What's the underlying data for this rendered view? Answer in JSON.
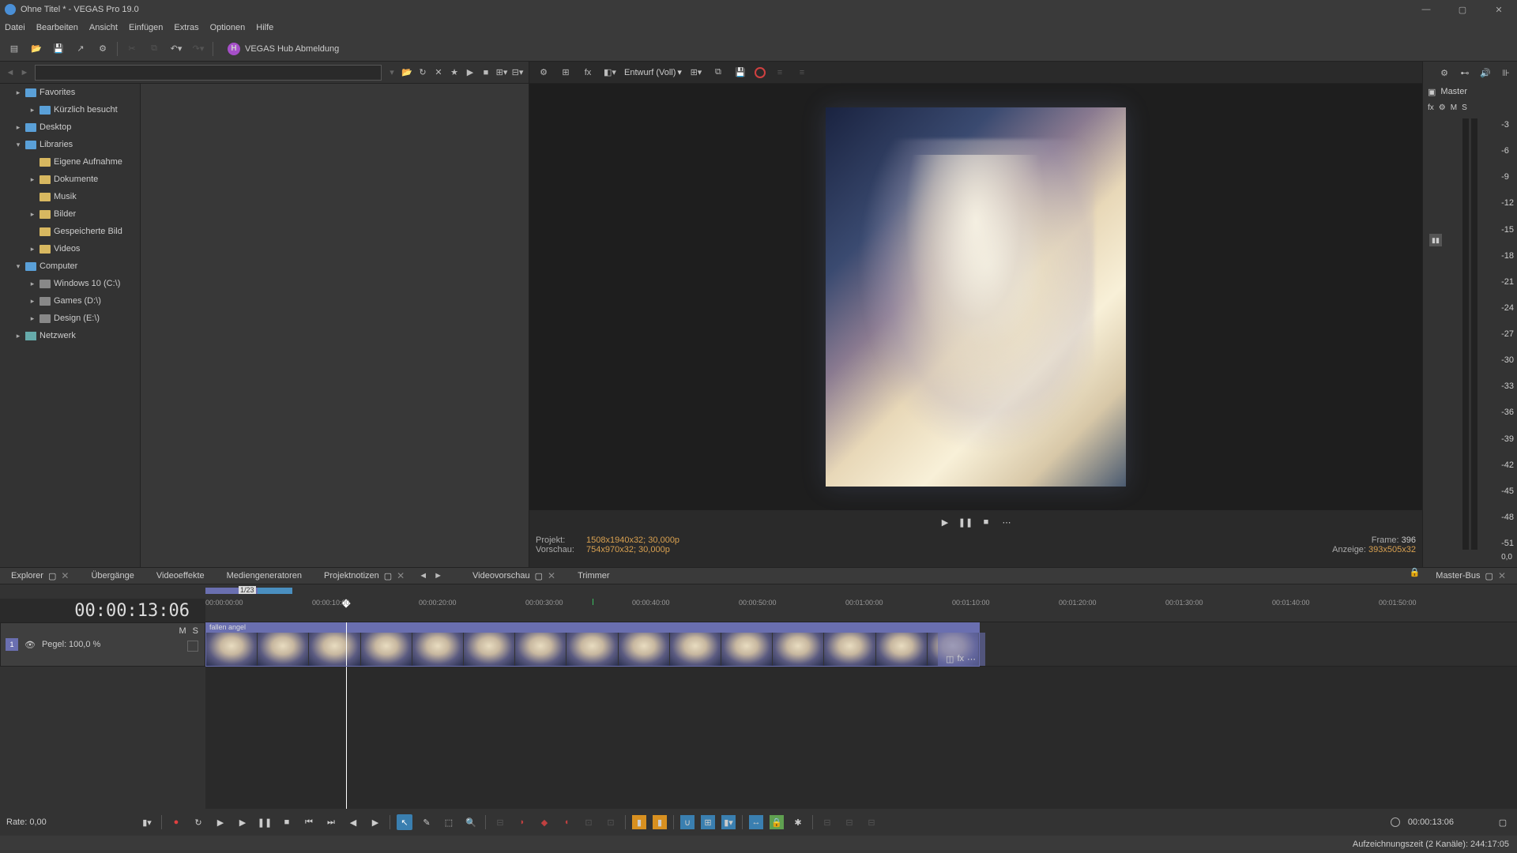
{
  "title": "Ohne Titel * - VEGAS Pro 19.0",
  "menu": [
    "Datei",
    "Bearbeiten",
    "Ansicht",
    "Einfügen",
    "Extras",
    "Optionen",
    "Hilfe"
  ],
  "hub": {
    "initial": "H",
    "label": "VEGAS Hub Abmeldung"
  },
  "tree": [
    {
      "label": "Favorites",
      "level": 1,
      "expandable": true,
      "icon": "folder",
      "blue": true
    },
    {
      "label": "Kürzlich besucht",
      "level": 2,
      "expandable": true,
      "icon": "folder",
      "blue": true
    },
    {
      "label": "Desktop",
      "level": 1,
      "expandable": true,
      "icon": "folder",
      "blue": true
    },
    {
      "label": "Libraries",
      "level": 1,
      "expanded": true,
      "icon": "folder",
      "blue": true
    },
    {
      "label": "Eigene Aufnahme",
      "level": 2,
      "icon": "folder"
    },
    {
      "label": "Dokumente",
      "level": 2,
      "expandable": true,
      "icon": "folder"
    },
    {
      "label": "Musik",
      "level": 2,
      "icon": "folder"
    },
    {
      "label": "Bilder",
      "level": 2,
      "expandable": true,
      "icon": "folder"
    },
    {
      "label": "Gespeicherte Bild",
      "level": 2,
      "icon": "folder"
    },
    {
      "label": "Videos",
      "level": 2,
      "expandable": true,
      "icon": "folder"
    },
    {
      "label": "Computer",
      "level": 1,
      "expanded": true,
      "icon": "folder",
      "blue": true
    },
    {
      "label": "Windows 10 (C:\\)",
      "level": 2,
      "expandable": true,
      "icon": "drive"
    },
    {
      "label": "Games (D:\\)",
      "level": 2,
      "expandable": true,
      "icon": "drive"
    },
    {
      "label": "Design (E:\\)",
      "level": 2,
      "expandable": true,
      "icon": "drive"
    },
    {
      "label": "Netzwerk",
      "level": 1,
      "expandable": true,
      "icon": "net"
    }
  ],
  "preview": {
    "quality": "Entwurf (Voll)",
    "projekt_label": "Projekt:",
    "projekt_val": "1508x1940x32; 30,000p",
    "vorschau_label": "Vorschau:",
    "vorschau_val": "754x970x32; 30,000p",
    "anzeige_label": "Anzeige:",
    "anzeige_val": "393x505x32",
    "frame_label": "Frame:",
    "frame_val": "396"
  },
  "left_tabs": [
    "Explorer",
    "Übergänge",
    "Videoeffekte",
    "Mediengeneratoren",
    "Projektnotizen"
  ],
  "left_tabs_active": 4,
  "preview_tabs": [
    "Videovorschau",
    "Trimmer"
  ],
  "preview_tabs_active": 0,
  "right_tab": "Master-Bus",
  "master": {
    "title": "Master",
    "sub": [
      "fx",
      "⚙",
      "M",
      "S"
    ]
  },
  "meter_scale": [
    "-3",
    "-6",
    "-9",
    "-12",
    "-15",
    "-18",
    "-21",
    "-24",
    "-27",
    "-30",
    "-33",
    "-36",
    "-39",
    "-42",
    "-45",
    "-48",
    "-51"
  ],
  "meter_val": "0,0",
  "timeline": {
    "overview_len": "1/23",
    "timecode": "00:00:13:06",
    "ruler": [
      "00:00:00:00",
      "00:00:10:00",
      "00:00:20:00",
      "00:00:30:00",
      "00:00:40:00",
      "00:00:50:00",
      "00:01:00:00",
      "00:01:10:00",
      "00:01:20:00",
      "00:01:30:00",
      "00:01:40:00",
      "00:01:50:00"
    ],
    "track": {
      "num": "1",
      "ms": [
        "M",
        "S"
      ],
      "pegel_label": "Pegel:",
      "pegel_val": "100,0 %"
    },
    "clip_name": "fallen angel"
  },
  "bottom": {
    "rate_label": "Rate:",
    "rate_val": "0,00",
    "tc": "00:00:13:06"
  },
  "status": "Aufzeichnungszeit (2 Kanäle): 244:17:05"
}
